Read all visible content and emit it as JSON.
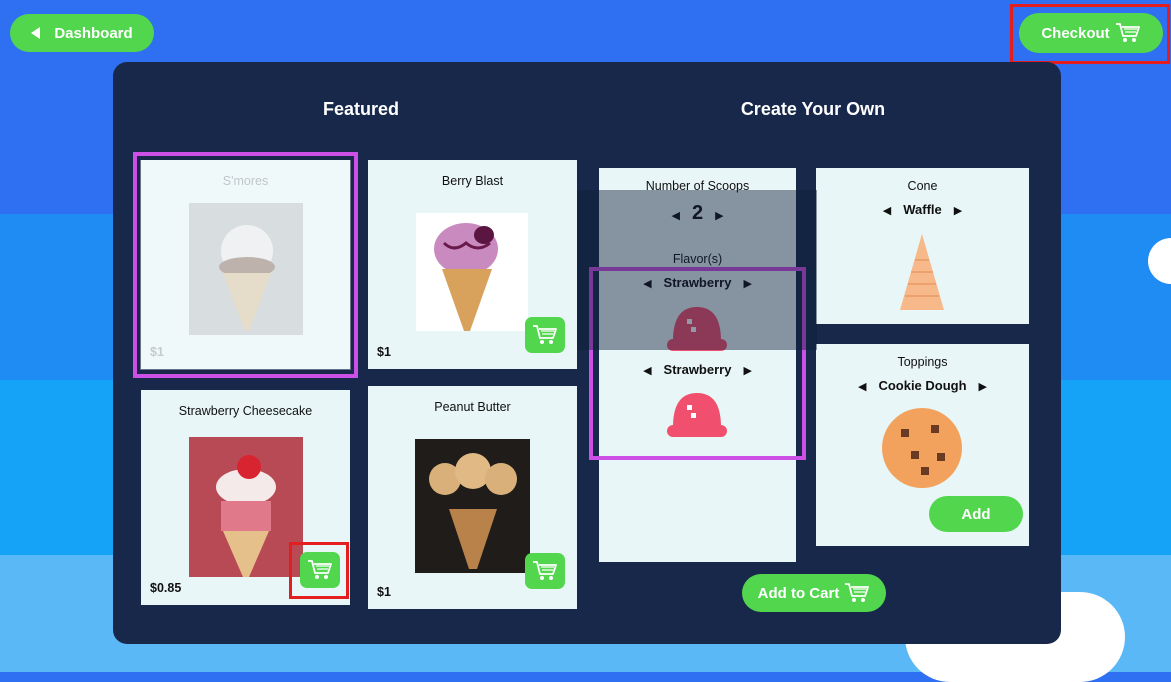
{
  "nav": {
    "dashboard_label": "Dashboard",
    "checkout_label": "Checkout"
  },
  "featured": {
    "title": "Featured",
    "items": [
      {
        "name": "S'mores",
        "price": "$1"
      },
      {
        "name": "Berry Blast",
        "price": "$1"
      },
      {
        "name": "Strawberry Cheesecake",
        "price": "$0.85"
      },
      {
        "name": "Peanut Butter",
        "price": "$1"
      }
    ]
  },
  "custom": {
    "title": "Create Your Own",
    "scoops_label": "Number of Scoops",
    "scoops_value": "2",
    "flavors_label": "Flavor(s)",
    "flavor1": "Strawberry",
    "flavor2": "Strawberry",
    "cone_label": "Cone",
    "cone_value": "Waffle",
    "toppings_label": "Toppings",
    "topping_value": "Cookie Dough",
    "add_label": "Add",
    "add_to_cart_label": "Add to Cart"
  },
  "colors": {
    "accent_green": "#52d64e",
    "panel": "#17284a",
    "card": "#e8f6f8",
    "strawberry": "#f0506e"
  },
  "icons": [
    "back-arrow-icon",
    "shopping-cart-icon",
    "arrow-left-icon",
    "arrow-right-icon"
  ]
}
